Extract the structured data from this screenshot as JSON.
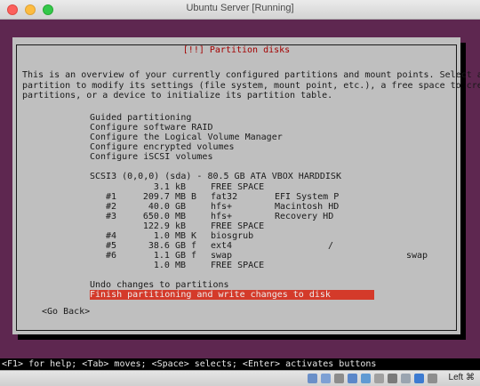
{
  "window": {
    "title": "Ubuntu Server [Running]"
  },
  "dialog": {
    "title": "[!!] Partition disks",
    "description": [
      "This is an overview of your currently configured partitions and mount points. Select a",
      "partition to modify its settings (file system, mount point, etc.), a free space to create",
      "partitions, or a device to initialize its partition table."
    ],
    "options": [
      "Guided partitioning",
      "Configure software RAID",
      "Configure the Logical Volume Manager",
      "Configure encrypted volumes",
      "Configure iSCSI volumes"
    ],
    "disk": "SCSI3 (0,0,0) (sda) - 80.5 GB ATA VBOX HARDDISK",
    "partitions": [
      {
        "num": "",
        "size": "3.1 kB",
        "flag": "",
        "fs": "FREE SPACE",
        "name": "",
        "mount": ""
      },
      {
        "num": "#1",
        "size": "209.7 MB",
        "flag": "B",
        "fs": "fat32",
        "name": "EFI System P",
        "mount": ""
      },
      {
        "num": "#2",
        "size": "40.0 GB",
        "flag": "",
        "fs": "hfs+",
        "name": "Macintosh HD",
        "mount": ""
      },
      {
        "num": "#3",
        "size": "650.0 MB",
        "flag": "",
        "fs": "hfs+",
        "name": "Recovery HD",
        "mount": ""
      },
      {
        "num": "",
        "size": "122.9 kB",
        "flag": "",
        "fs": "FREE SPACE",
        "name": "",
        "mount": ""
      },
      {
        "num": "#4",
        "size": "1.0 MB",
        "flag": "K",
        "fs": "biosgrub",
        "name": "",
        "mount": ""
      },
      {
        "num": "#5",
        "size": "38.6 GB",
        "flag": "f",
        "fs": "ext4",
        "name": "",
        "mount": "/"
      },
      {
        "num": "#6",
        "size": "1.1 GB",
        "flag": "f",
        "fs": "swap",
        "name": "",
        "mount": "swap"
      },
      {
        "num": "",
        "size": "1.0 MB",
        "flag": "",
        "fs": "FREE SPACE",
        "name": "",
        "mount": ""
      }
    ],
    "undo": "Undo changes to partitions",
    "finish": "Finish partitioning and write changes to disk",
    "go_back": "<Go Back>"
  },
  "help_line": "<F1> for help; <Tab> moves; <Space> selects; <Enter> activates buttons",
  "status": {
    "host_key": "Left ⌘"
  },
  "colors": {
    "console_bg": "#5e2750",
    "dialog_bg": "#bfbfbf",
    "highlight": "#d43a2a",
    "title_red": "#a40000"
  }
}
